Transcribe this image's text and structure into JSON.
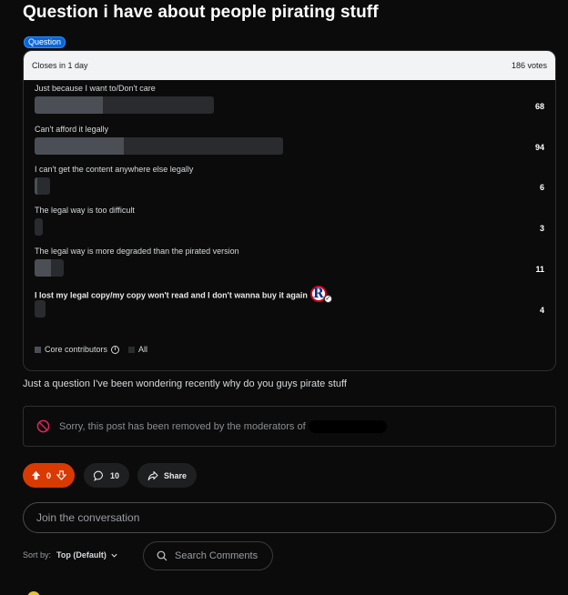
{
  "post": {
    "title": "Question i have about people pirating stuff",
    "flair": "Question",
    "body": "Just a question I've been wondering recently why do you guys pirate stuff"
  },
  "poll": {
    "closes": "Closes in 1 day",
    "total_votes": "186 votes",
    "options": [
      {
        "label": "Just because I want to/Don't care",
        "count": "68",
        "votes": 68,
        "core_votes": 26
      },
      {
        "label": "Can't afford it legally",
        "count": "94",
        "votes": 94,
        "core_votes": 34
      },
      {
        "label": "I can't get the content anywhere else legally",
        "count": "6",
        "votes": 6,
        "core_votes": 1
      },
      {
        "label": "The legal way is too difficult",
        "count": "3",
        "votes": 3,
        "core_votes": 0
      },
      {
        "label": "The legal way is more degraded than the pirated version",
        "count": "11",
        "votes": 11,
        "core_votes": 6
      },
      {
        "label": "I lost my legal copy/my copy won't read and I don't wanna buy it again",
        "count": "4",
        "votes": 4,
        "core_votes": 0,
        "selected": true
      }
    ],
    "legend": {
      "core": "Core contributors",
      "all": "All"
    }
  },
  "removed_notice": "Sorry, this post has been removed by the moderators of",
  "actions": {
    "votes": "0",
    "comments": "10",
    "share": "Share"
  },
  "comment_box": {
    "placeholder": "Join the conversation"
  },
  "sort": {
    "label": "Sort by:",
    "value": "Top (Default)"
  },
  "search_comments": "Search Comments",
  "colors": {
    "upvote_bg": "#d93a00",
    "flair_bg": "#0a66d6",
    "removed_icon": "#e0245e"
  }
}
